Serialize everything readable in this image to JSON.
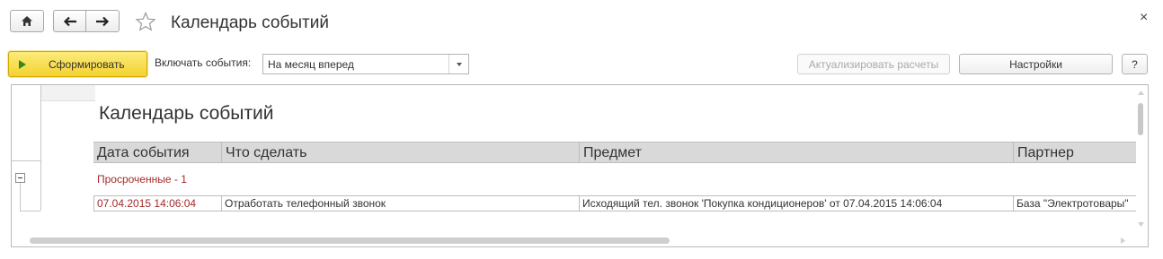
{
  "window": {
    "title": "Календарь событий",
    "close_glyph": "×"
  },
  "toolbar": {
    "generate_label": "Сформировать",
    "include_events_label": "Включать события:",
    "include_events_value": "На месяц вперед",
    "actualize_label": "Актуализировать расчеты",
    "settings_label": "Настройки",
    "help_label": "?"
  },
  "report": {
    "title": "Календарь событий",
    "columns": [
      "Дата события",
      "Что сделать",
      "Предмет",
      "Партнер"
    ],
    "group_label": "Просроченные - 1",
    "rows": [
      {
        "date": "07.04.2015 14:06:04",
        "task": "Отработать телефонный звонок",
        "subject": "Исходящий тел. звонок 'Покупка кондиционеров' от 07.04.2015 14:06:04",
        "partner": "База \"Электротовары\""
      }
    ]
  },
  "colors": {
    "generate_button": "#f3d230",
    "overdue_text": "#a52a2a",
    "header_bg": "#d9d9d9"
  },
  "icons": [
    "home-icon",
    "back-arrow-icon",
    "forward-arrow-icon",
    "favorite-star-icon",
    "play-icon",
    "dropdown-arrow-icon",
    "collapse-minus-icon"
  ]
}
